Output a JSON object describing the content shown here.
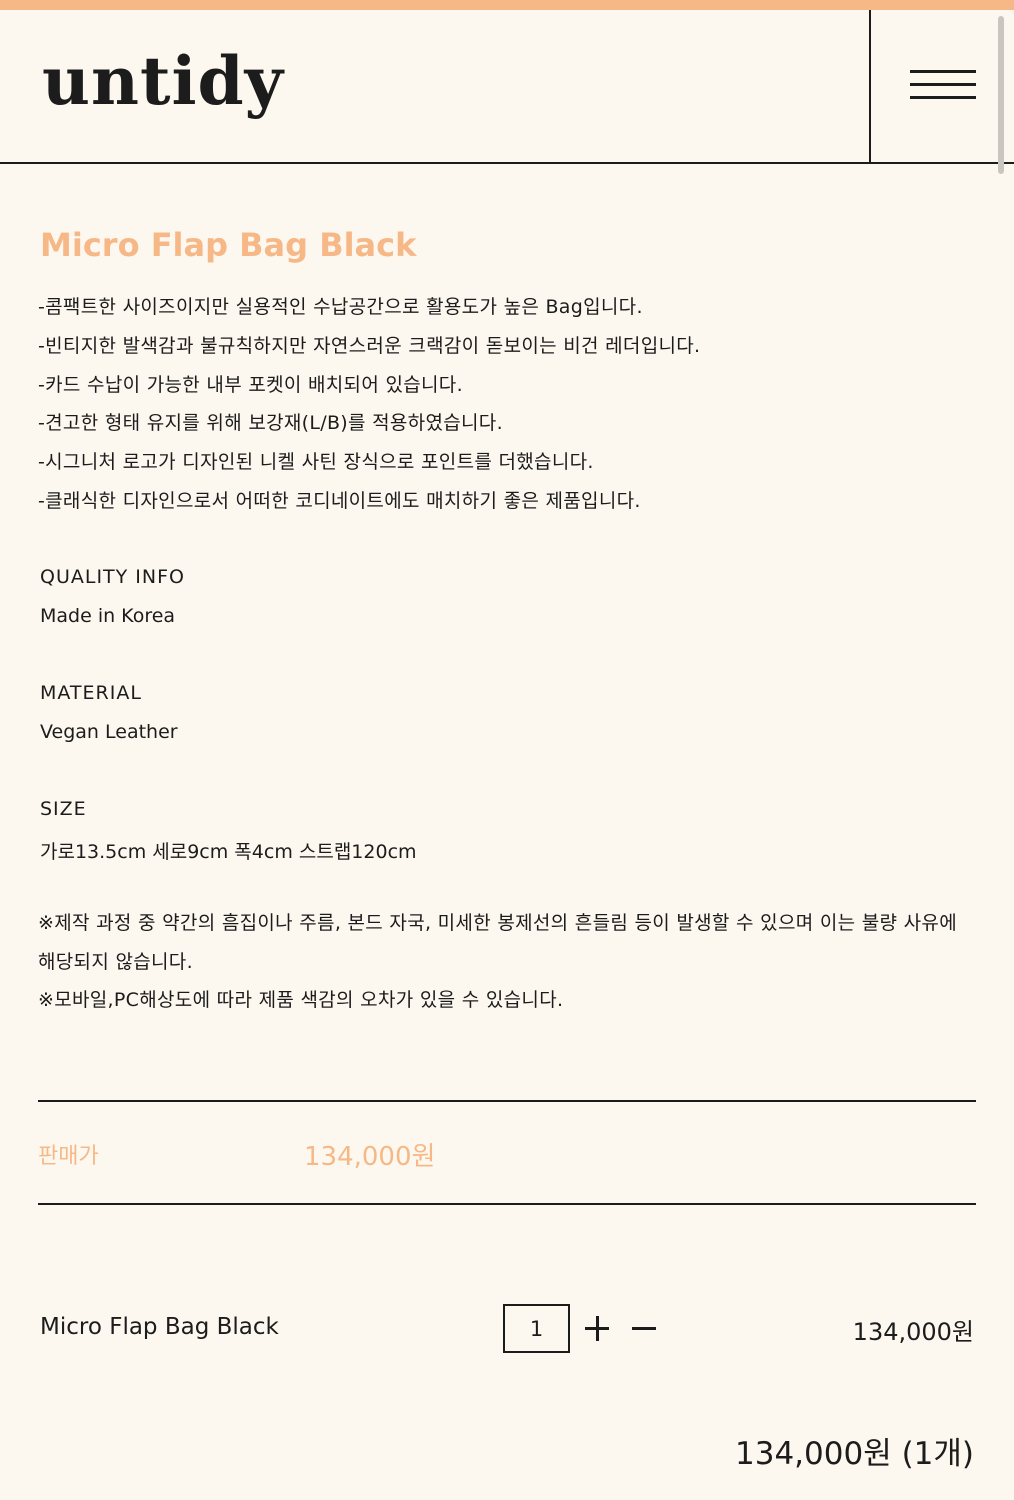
{
  "colors": {
    "accent": "#f7b887",
    "text": "#1c1c1c",
    "background": "#fdf8ef"
  },
  "header": {
    "logo": "untidy",
    "menu_icon": "hamburger-menu-icon"
  },
  "product": {
    "title": "Micro Flap Bag Black",
    "description": [
      "-콤팩트한 사이즈이지만 실용적인 수납공간으로 활용도가 높은 Bag입니다.",
      "-빈티지한 발색감과 불규칙하지만 자연스러운 크랙감이 돋보이는 비건 레더입니다.",
      "-카드 수납이 가능한 내부 포켓이 배치되어 있습니다.",
      "-견고한 형태 유지를 위해 보강재(L/B)를 적용하였습니다.",
      "-시그니처 로고가 디자인된 니켈 사틴 장식으로 포인트를 더했습니다.",
      "-클래식한 디자인으로서 어떠한 코디네이트에도 매치하기 좋은 제품입니다."
    ],
    "quality_info": {
      "label": "QUALITY INFO",
      "value": "Made in Korea"
    },
    "material": {
      "label": "MATERIAL",
      "value": "Vegan Leather"
    },
    "size": {
      "label": "SIZE",
      "value": "가로13.5cm 세로9cm 폭4cm 스트랩120cm"
    },
    "notes": [
      "※제작 과정 중 약간의 흠집이나 주름, 본드 자국, 미세한 봉제선의 흔들림 등이 발생할 수 있으며 이는 불량 사유에 해당되지 않습니다.",
      "※모바일,PC해상도에 따라 제품 색감의 오차가 있을 수 있습니다."
    ]
  },
  "pricing": {
    "label": "판매가",
    "value": "134,000원"
  },
  "order": {
    "item_name": "Micro Flap Bag Black",
    "quantity": "1",
    "line_total": "134,000원",
    "grand_total": "134,000원 (1개)",
    "increase_icon": "plus-icon",
    "decrease_icon": "minus-icon"
  }
}
